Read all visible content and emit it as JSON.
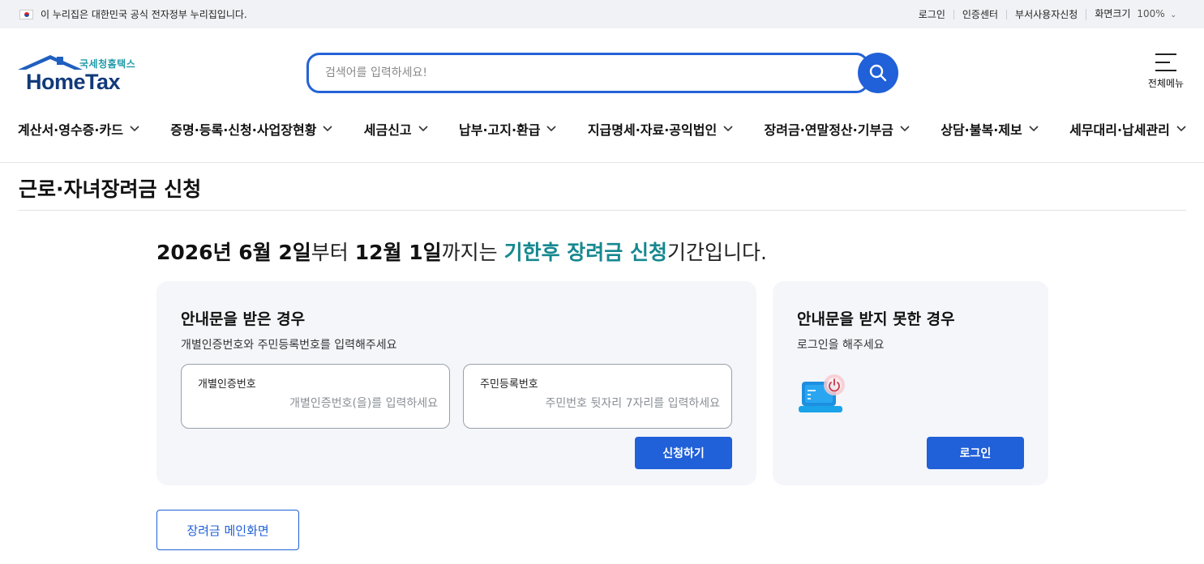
{
  "topbar": {
    "gov_notice": "이 누리집은 대한민국 공식 전자정부 누리집입니다.",
    "links": [
      "로그인",
      "인증센터",
      "부서사용자신청"
    ],
    "zoom_label": "화면크기",
    "zoom_value": "100%"
  },
  "header": {
    "logo_ko": "국세청홈택스",
    "logo_en": "HomeTax",
    "search_placeholder": "검색어를 입력하세요!",
    "all_menu_label": "전체메뉴"
  },
  "gnb": {
    "items": [
      "계산서·영수증·카드",
      "증명·등록·신청·사업장현황",
      "세금신고",
      "납부·고지·환급",
      "지급명세·자료·공익법인",
      "장려금·연말정산·기부금",
      "상담·불복·제보",
      "세무대리·납세관리"
    ]
  },
  "page": {
    "title": "근로·자녀장려금 신청",
    "period": {
      "start": "2026년 6월 2일",
      "from": "부터 ",
      "end": "12월 1일",
      "until": "까지는 ",
      "highlight": "기한후 장려금 신청",
      "suffix": "기간입니다."
    }
  },
  "card_notice": {
    "title": "안내문을 받은 경우",
    "subtitle": "개별인증번호와 주민등록번호를 입력해주세요",
    "field1_label": "개별인증번호",
    "field1_placeholder": "개별인증번호(을)를 입력하세요",
    "field2_label": "주민등록번호",
    "field2_placeholder": "주민번호 뒷자리 7자리를 입력하세요",
    "button": "신청하기"
  },
  "card_login": {
    "title": "안내문을 받지 못한 경우",
    "subtitle": "로그인을 해주세요",
    "button": "로그인"
  },
  "footer_button": "장려금 메인화면",
  "colors": {
    "primary": "#2060d8",
    "highlight": "#16888f",
    "card_bg": "#f4f6fa"
  }
}
